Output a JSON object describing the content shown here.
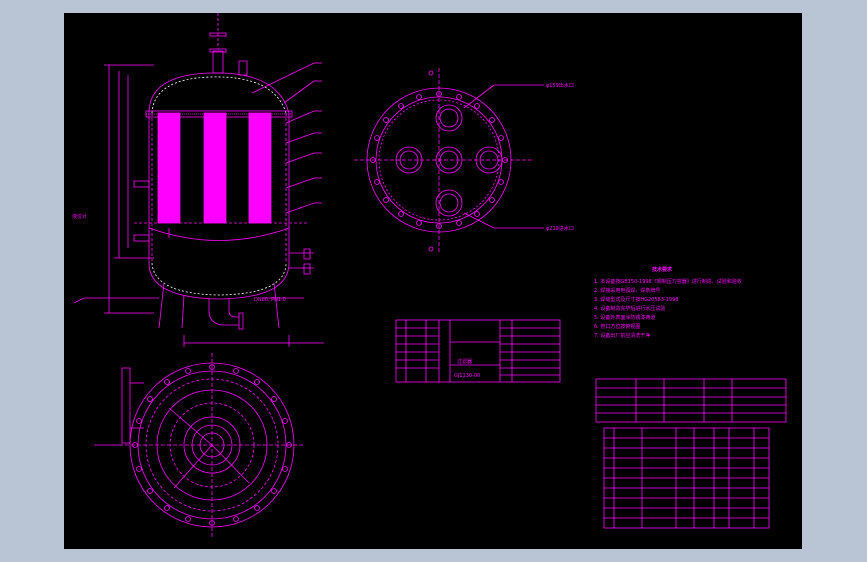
{
  "colors": {
    "background": "#000000",
    "frame": "#b9c4d4",
    "drawing": "#ff00ff",
    "white": "#ffffff",
    "red": "#ff2020"
  },
  "drawing": {
    "notes_title": "技术要求",
    "notes": [
      "1. 本设备按GB150-1998《钢制压力容器》进行制造、试验和验收",
      "2. 焊接采用电弧焊，焊条牌号",
      "3. 焊缝型式及尺寸按HG20583-1998",
      "4. 设备制造完毕后进行水压试验",
      "5. 设备外表面涂防锈漆两道",
      "6. 管口方位按俯视图",
      "7. 设备出厂前应清洗干净"
    ],
    "top_view_callouts": [
      "φ159出水口",
      "φ219进水口"
    ],
    "title_block": {
      "name": "过滤器",
      "drawing_no": "GJ1130-00"
    },
    "side_label_left": "液位计",
    "side_label_bottom": "DN80, PN1.0"
  }
}
